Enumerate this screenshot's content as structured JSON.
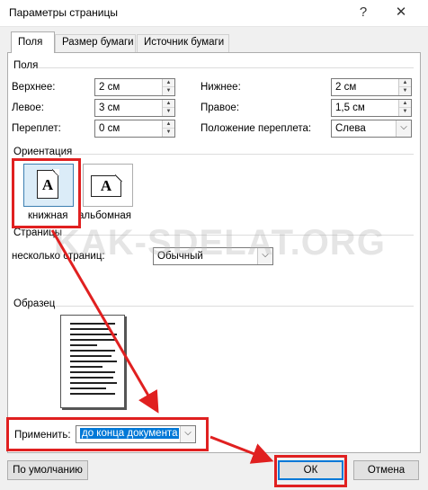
{
  "window": {
    "title": "Параметры страницы",
    "help": "?",
    "close": "✕"
  },
  "tabs": [
    {
      "label": "Поля",
      "active": true
    },
    {
      "label": "Размер бумаги",
      "active": false
    },
    {
      "label": "Источник бумаги",
      "active": false
    }
  ],
  "margins": {
    "group_label": "Поля",
    "top": {
      "label": "Верхнее:",
      "value": "2 см"
    },
    "bottom": {
      "label": "Нижнее:",
      "value": "2 см"
    },
    "left": {
      "label": "Левое:",
      "value": "3 см"
    },
    "right": {
      "label": "Правое:",
      "value": "1,5 см"
    },
    "gutter": {
      "label": "Переплет:",
      "value": "0 см"
    },
    "gutter_position": {
      "label": "Положение переплета:",
      "value": "Слева"
    }
  },
  "orientation": {
    "group_label": "Ориентация",
    "portrait": {
      "label": "книжная",
      "glyph": "A",
      "selected": true
    },
    "landscape": {
      "label": "альбомная",
      "glyph": "A",
      "selected": false
    }
  },
  "pages": {
    "group_label": "Страницы",
    "multiple_label": "несколько страниц:",
    "multiple_value": "Обычный"
  },
  "preview": {
    "group_label": "Образец",
    "apply_label": "Применить:",
    "apply_value": "до конца документа"
  },
  "buttons": {
    "default": "По умолчанию",
    "ok": "ОК",
    "cancel": "Отмена"
  },
  "watermark": "KAK-SDELAT.ORG",
  "colors": {
    "highlight": "#e02020",
    "accent": "#0078d7"
  },
  "icons": {
    "spin_up": "▲",
    "spin_down": "▼",
    "dropdown": "⌵"
  }
}
